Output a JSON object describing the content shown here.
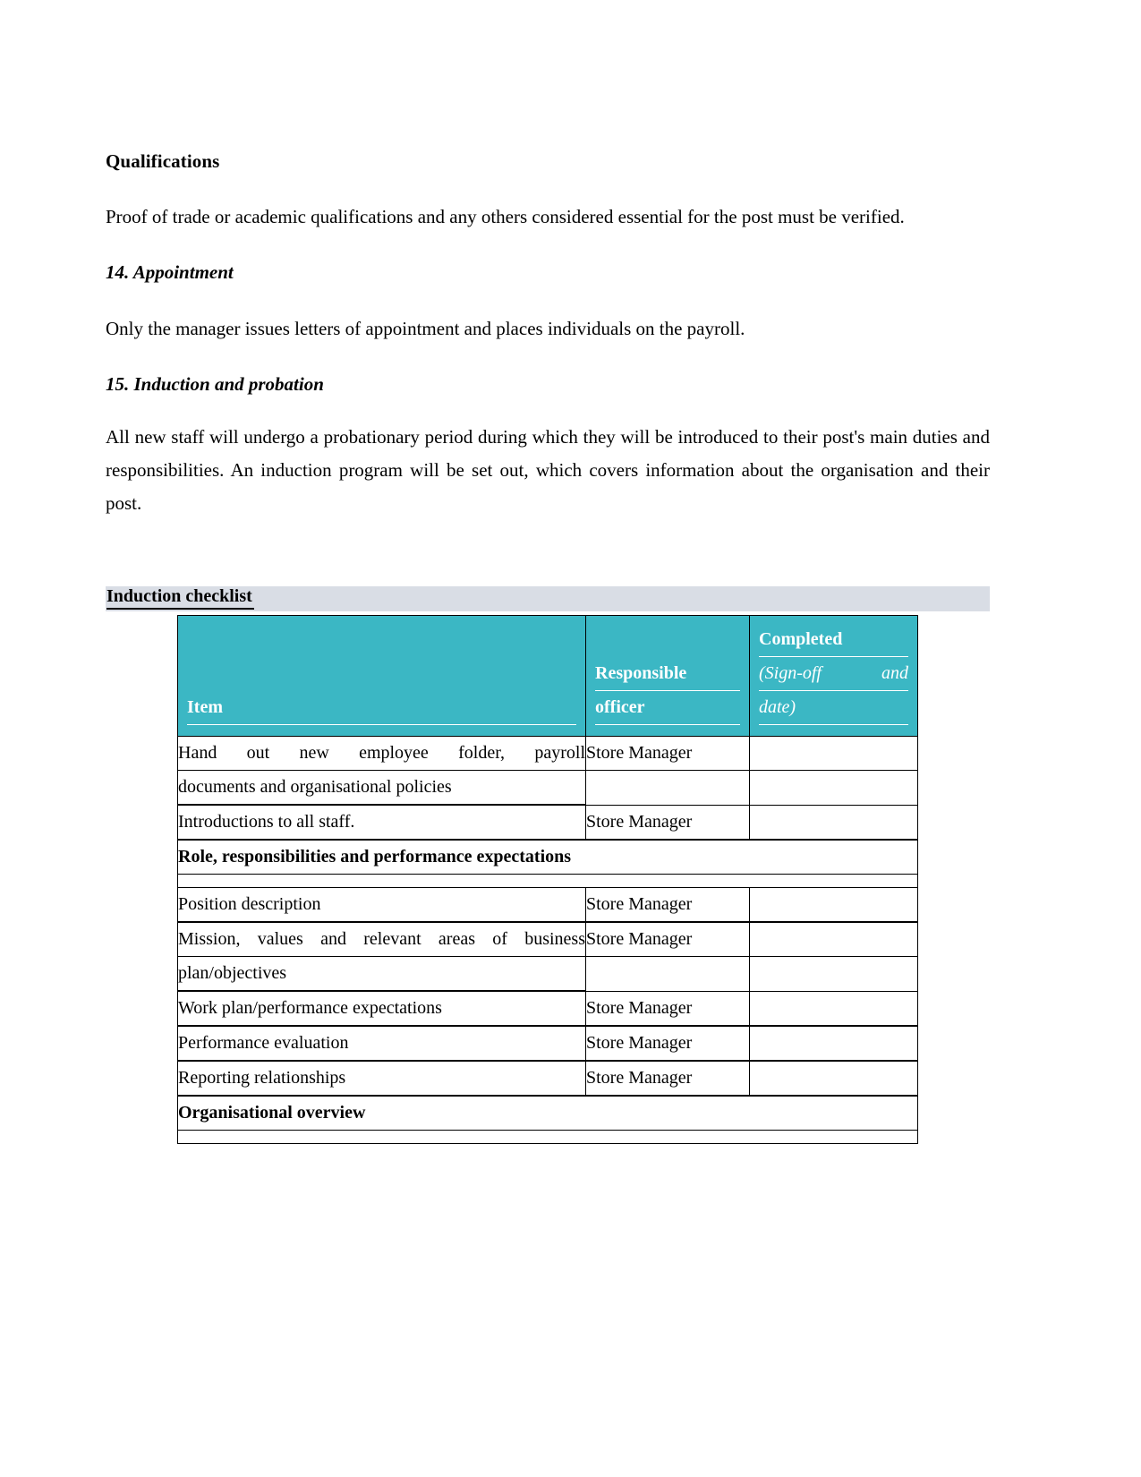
{
  "document": {
    "blocks": [
      {
        "kind": "heading",
        "text": "Qualifications"
      },
      {
        "kind": "paragraph",
        "text": "Proof of trade or academic qualifications and any others considered essential for the post must be verified."
      },
      {
        "kind": "heading-italic",
        "text": "14. Appointment"
      },
      {
        "kind": "paragraph",
        "text": "Only the manager issues letters of appointment and places individuals on the payroll."
      },
      {
        "kind": "heading-italic",
        "text": "15. Induction and probation"
      },
      {
        "kind": "paragraph",
        "text": "All new staff will undergo a probationary period during which they will be introduced to their post's main duties and responsibilities. An induction program will be set out, which covers information about the organisation and their post."
      }
    ],
    "section_heading": "Induction checklist",
    "colors": {
      "section_heading_background": "#d9dde5",
      "table_header_background": "#3bb7c4",
      "table_header_text": "#ffffff",
      "border": "#000000",
      "page_background": "#ffffff"
    }
  },
  "table": {
    "headers": {
      "item": "Item",
      "responsible_officer_line1": "Responsible",
      "responsible_officer_line2": "officer",
      "completed": "Completed",
      "completed_note_line1_left": "(Sign-off",
      "completed_note_line1_right": "and",
      "completed_note_line2": "date)"
    },
    "rows": [
      {
        "type": "item",
        "item_lines": [
          "Hand out new employee folder, payroll",
          "documents and organisational policies"
        ],
        "item_justify": [
          true,
          false
        ],
        "responsible_officer": "Store Manager",
        "completed": ""
      },
      {
        "type": "item",
        "item_lines": [
          "Introductions to all staff."
        ],
        "item_justify": [
          false
        ],
        "responsible_officer": "Store Manager",
        "completed": ""
      },
      {
        "type": "section",
        "title": "Role, responsibilities and performance expectations"
      },
      {
        "type": "item",
        "item_lines": [
          "Position description"
        ],
        "item_justify": [
          false
        ],
        "responsible_officer": "Store Manager",
        "completed": ""
      },
      {
        "type": "item",
        "item_lines": [
          "Mission, values and relevant areas of business",
          "plan/objectives"
        ],
        "item_justify": [
          true,
          false
        ],
        "responsible_officer": "Store Manager",
        "completed": ""
      },
      {
        "type": "item",
        "item_lines": [
          "Work plan/performance expectations"
        ],
        "item_justify": [
          false
        ],
        "responsible_officer": "Store Manager",
        "completed": ""
      },
      {
        "type": "item",
        "item_lines": [
          "Performance evaluation"
        ],
        "item_justify": [
          false
        ],
        "responsible_officer": "Store Manager",
        "completed": ""
      },
      {
        "type": "item",
        "item_lines": [
          "Reporting relationships"
        ],
        "item_justify": [
          false
        ],
        "responsible_officer": "Store Manager",
        "completed": ""
      },
      {
        "type": "section",
        "title": "Organisational overview"
      }
    ]
  }
}
